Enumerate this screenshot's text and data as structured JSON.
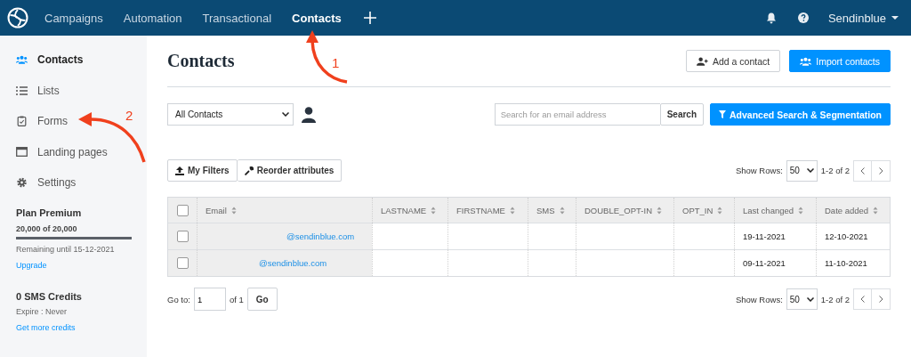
{
  "topbar": {
    "nav": [
      {
        "label": "Campaigns",
        "selected": false
      },
      {
        "label": "Automation",
        "selected": false
      },
      {
        "label": "Transactional",
        "selected": false
      },
      {
        "label": "Contacts",
        "selected": true
      }
    ],
    "account": "Sendinblue"
  },
  "sidebar": {
    "items": [
      {
        "label": "Contacts",
        "selected": true
      },
      {
        "label": "Lists",
        "selected": false
      },
      {
        "label": "Forms",
        "selected": false
      },
      {
        "label": "Landing pages",
        "selected": false
      },
      {
        "label": "Settings",
        "selected": false
      }
    ],
    "plan": {
      "title": "Plan Premium",
      "usage": "20,000 of 20,000",
      "level": 1,
      "remaining": "Remaining until 15-12-2021",
      "link": "Upgrade"
    },
    "sms": {
      "title": "0 SMS Credits",
      "expire": "Expire : Never",
      "link": "Get more credits"
    }
  },
  "page": {
    "title": "Contacts",
    "buttons": [
      {
        "label": "Add a contact",
        "kind": "outline"
      },
      {
        "label": "Import contacts",
        "kind": "primary"
      }
    ]
  },
  "filter": {
    "list": "All Contacts",
    "search_placeholder": "Search for an email address",
    "search_button": "Search",
    "advanced_button": "Advanced Search & Segmentation"
  },
  "toolbar": {
    "buttons": [
      "My Filters",
      "Reorder attributes"
    ],
    "show_rows_label": "Show Rows:",
    "show_rows": "50",
    "range": "1-2 of 2"
  },
  "table": {
    "header_checked": false,
    "columns": [
      "Email",
      "LASTNAME",
      "FIRSTNAME",
      "SMS",
      "DOUBLE_OPT-IN",
      "OPT_IN",
      "Last changed",
      "Date added"
    ],
    "rows": [
      {
        "checked": false,
        "cells": [
          "@sendinblue.com",
          "",
          "",
          "",
          "",
          "",
          "19-11-2021",
          "12-10-2021"
        ]
      },
      {
        "checked": false,
        "cells": [
          "@sendinblue.com",
          "",
          "",
          "",
          "",
          "",
          "09-11-2021",
          "11-10-2021"
        ]
      }
    ]
  },
  "pagination": {
    "goto_label": "Go to:",
    "page": "1",
    "of": "of 1",
    "go": "Go",
    "show_rows_label": "Show Rows:",
    "show_rows": "50",
    "range": "1-2 of 2"
  },
  "annotations": [
    {
      "label": "1"
    },
    {
      "label": "2"
    }
  ]
}
